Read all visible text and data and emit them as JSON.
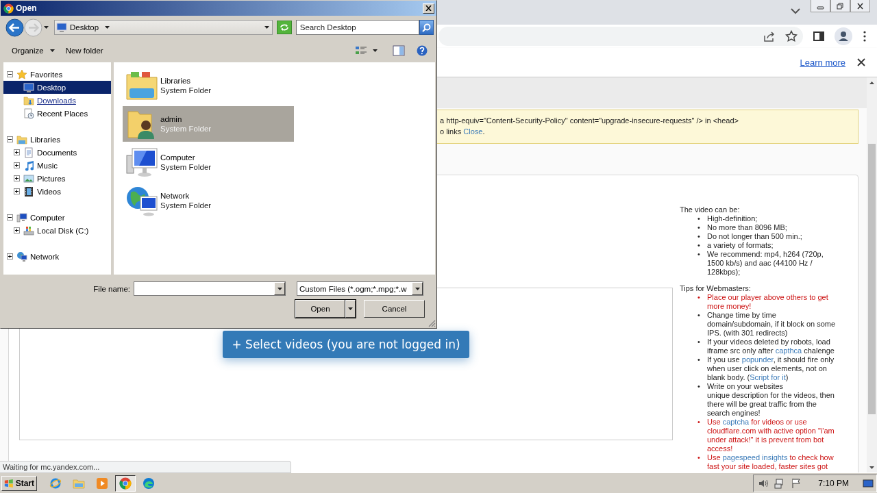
{
  "browser": {
    "infobar": {
      "link": "Learn more"
    },
    "notice": {
      "lines": [
        [
          {
            "text": "a http-equiv=\"Content-Security-Policy\" content=\"upgrade-insecure-requests\" /> in <head>",
            "link": false
          }
        ],
        [
          {
            "text": "o links ",
            "link": false
          },
          {
            "text": "Close",
            "link": true
          },
          {
            "text": ".",
            "link": false
          }
        ]
      ]
    },
    "upload_button": "+ Select videos (you are not logged in)",
    "info": [
      {
        "heading": "The video can be:",
        "items": [
          {
            "marker": "•",
            "highlighted": false,
            "segments": [
              {
                "text": "High-definition;",
                "link": false
              }
            ]
          },
          {
            "marker": "•",
            "highlighted": false,
            "segments": [
              {
                "text": "No more than 8096 MB;",
                "link": false
              }
            ]
          },
          {
            "marker": "•",
            "highlighted": false,
            "segments": [
              {
                "text": "Do not longer than 500 min.;",
                "link": false
              }
            ]
          },
          {
            "marker": "•",
            "highlighted": false,
            "segments": [
              {
                "text": "a variety of formats;",
                "link": false
              }
            ]
          },
          {
            "marker": "•",
            "highlighted": false,
            "segments": [
              {
                "text": "We recommend: mp4, h264 (720p, 1500 kb/s) and aac (44100 Hz / 128kbps);",
                "link": false
              }
            ]
          }
        ]
      },
      {
        "heading": "Tips for Webmasters:",
        "items": [
          {
            "marker": "•",
            "highlighted": true,
            "segments": [
              {
                "text": "Place our player above others to get more money!",
                "link": false
              }
            ]
          },
          {
            "marker": "•",
            "highlighted": false,
            "segments": [
              {
                "text": "Change time by time domain/subdomain, if it block on some IPS. (with 301 redirects)",
                "link": false
              }
            ]
          },
          {
            "marker": "•",
            "highlighted": false,
            "segments": [
              {
                "text": "If your videos deleted by robots, load iframe src only after ",
                "link": false
              },
              {
                "text": "capthca",
                "link": true
              },
              {
                "text": " chalenge",
                "link": false
              }
            ]
          },
          {
            "marker": "•",
            "highlighted": false,
            "segments": [
              {
                "text": "If you use ",
                "link": false
              },
              {
                "text": "popunder",
                "link": true
              },
              {
                "text": ", it should fire only when user click on elements, not on blank body. (",
                "link": false
              },
              {
                "text": "Script for it",
                "link": true
              },
              {
                "text": ")",
                "link": false
              }
            ]
          },
          {
            "marker": "•",
            "highlighted": false,
            "segments": [
              {
                "text": "Write on your websites\nunique description for the videos, then there will be great traffic from the search engines!",
                "link": false
              }
            ]
          },
          {
            "marker": "•",
            "highlighted": true,
            "segments": [
              {
                "text": "Use ",
                "link": false
              },
              {
                "text": "captcha",
                "link": true
              },
              {
                "text": " for videos or use cloudflare.com with active option \"i'am under attack!\" it is prevent from bot access!",
                "link": false
              }
            ]
          },
          {
            "marker": "•",
            "highlighted": true,
            "segments": [
              {
                "text": "Use ",
                "link": false
              },
              {
                "text": "pagespeed insights",
                "link": true
              },
              {
                "text": " to check how fast your site loaded, faster sites got",
                "link": false
              }
            ]
          }
        ]
      }
    ],
    "status": "Waiting for mc.yandex.com..."
  },
  "dialog": {
    "title": "Open",
    "address": "Desktop",
    "search": {
      "placeholder": "Search Desktop"
    },
    "commands": [
      {
        "label": "Organize",
        "menu": true
      },
      {
        "label": "New folder",
        "menu": false
      }
    ],
    "tree": [
      {
        "label": "Favorites",
        "kind": "star",
        "expanded": true,
        "selected": false,
        "hovered": false,
        "children": [
          {
            "label": "Desktop",
            "kind": "desktop",
            "selected": true,
            "hovered": false
          },
          {
            "label": "Downloads",
            "kind": "downloads",
            "selected": false,
            "hovered": true
          },
          {
            "label": "Recent Places",
            "kind": "recent",
            "selected": false,
            "hovered": false
          }
        ]
      },
      {
        "label": "Libraries",
        "kind": "libraries",
        "expanded": true,
        "selected": false,
        "hovered": false,
        "children": [
          {
            "label": "Documents",
            "kind": "documents",
            "expanded": false,
            "selected": false,
            "hovered": false
          },
          {
            "label": "Music",
            "kind": "music",
            "expanded": false,
            "selected": false,
            "hovered": false
          },
          {
            "label": "Pictures",
            "kind": "pictures",
            "expanded": false,
            "selected": false,
            "hovered": false
          },
          {
            "label": "Videos",
            "kind": "videos",
            "expanded": false,
            "selected": false,
            "hovered": false
          }
        ]
      },
      {
        "label": "Computer",
        "kind": "computer",
        "expanded": true,
        "selected": false,
        "hovered": false,
        "children": [
          {
            "label": "Local Disk (C:)",
            "kind": "disk",
            "expanded": false,
            "selected": false,
            "hovered": false
          }
        ]
      },
      {
        "label": "Network",
        "kind": "network",
        "expanded": false,
        "selected": false,
        "hovered": false
      }
    ],
    "items": [
      {
        "name": "Libraries",
        "type": "System Folder",
        "kind": "libraries",
        "selected": false
      },
      {
        "name": "admin",
        "type": "System Folder",
        "kind": "user",
        "selected": true
      },
      {
        "name": "Computer",
        "type": "System Folder",
        "kind": "computer",
        "selected": false
      },
      {
        "name": "Network",
        "type": "System Folder",
        "kind": "network",
        "selected": false
      }
    ],
    "file_name_label": "File name:",
    "file_type": "Custom Files (*.ogm;*.mpg;*.w",
    "buttons": [
      {
        "label": "Open",
        "kind": "split"
      },
      {
        "label": "Cancel",
        "kind": "plain"
      }
    ]
  },
  "taskbar": {
    "start": "Start",
    "apps": [
      {
        "kind": "ie",
        "selected": false
      },
      {
        "kind": "explorer",
        "selected": false
      },
      {
        "kind": "media",
        "selected": false
      },
      {
        "kind": "chrome",
        "selected": true
      },
      {
        "kind": "edge",
        "selected": false
      }
    ],
    "clock": "7:10 PM"
  }
}
